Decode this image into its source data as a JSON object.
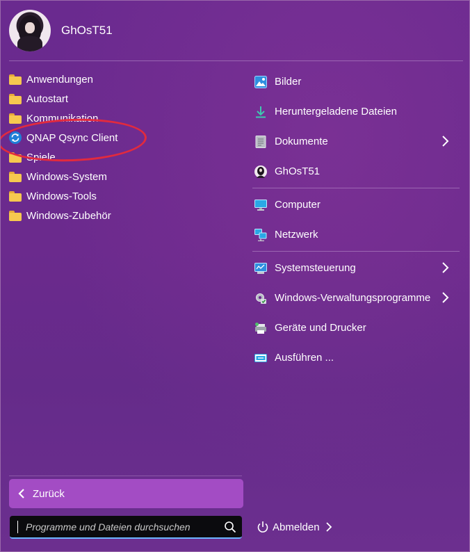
{
  "user": {
    "name": "GhOsT51"
  },
  "programs": [
    {
      "label": "Anwendungen",
      "icon": "folder-icon"
    },
    {
      "label": "Autostart",
      "icon": "folder-icon"
    },
    {
      "label": "Kommunikation",
      "icon": "folder-icon"
    },
    {
      "label": "QNAP Qsync Client",
      "icon": "qsync-icon"
    },
    {
      "label": "Spiele",
      "icon": "folder-icon"
    },
    {
      "label": "Windows-System",
      "icon": "folder-icon"
    },
    {
      "label": "Windows-Tools",
      "icon": "folder-icon"
    },
    {
      "label": "Windows-Zubehör",
      "icon": "folder-icon"
    }
  ],
  "places": [
    {
      "label": "Bilder",
      "icon": "pictures-icon",
      "has_submenu": false
    },
    {
      "label": "Heruntergeladene Dateien",
      "icon": "download-icon",
      "has_submenu": false
    },
    {
      "label": "Dokumente",
      "icon": "documents-icon",
      "has_submenu": true
    },
    {
      "label": "GhOsT51",
      "icon": "user-avatar-icon",
      "has_submenu": false
    },
    {
      "label": "Computer",
      "icon": "computer-icon",
      "has_submenu": false
    },
    {
      "label": "Netzwerk",
      "icon": "network-icon",
      "has_submenu": false
    },
    {
      "label": "Systemsteuerung",
      "icon": "control-panel-icon",
      "has_submenu": true
    },
    {
      "label": "Windows-Verwaltungsprogramme",
      "icon": "admin-tools-icon",
      "has_submenu": true
    },
    {
      "label": "Geräte und Drucker",
      "icon": "devices-printers-icon",
      "has_submenu": false
    },
    {
      "label": "Ausführen ...",
      "icon": "run-icon",
      "has_submenu": false
    }
  ],
  "back_button": {
    "label": "Zurück"
  },
  "search": {
    "placeholder": "Programme und Dateien durchsuchen",
    "value": ""
  },
  "logout": {
    "label": "Abmelden"
  },
  "colors": {
    "background": "#6a2a8f",
    "back_button": "#a34cc4",
    "annotation": "#e22a3e",
    "search_accent": "#6cb6ff"
  }
}
